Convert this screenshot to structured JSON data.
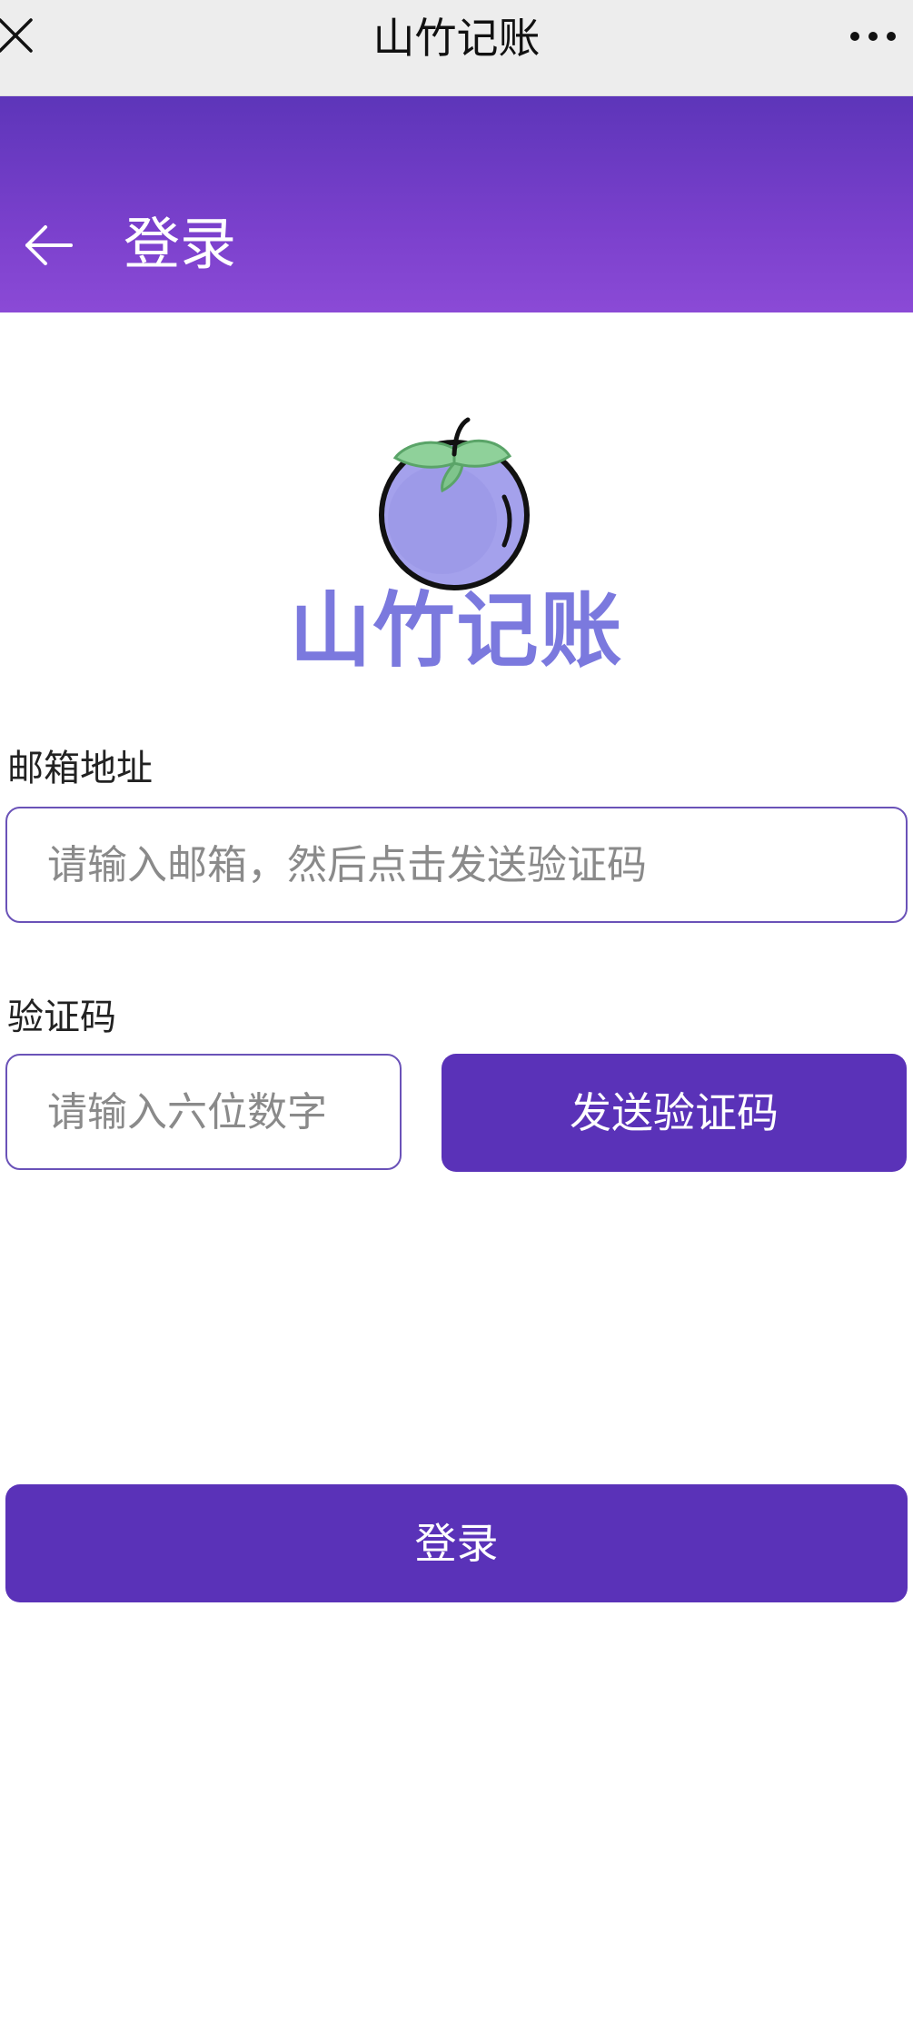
{
  "topbar": {
    "title": "山竹记账",
    "close_icon": "close-icon",
    "more_icon": "more-dots-icon"
  },
  "header": {
    "back_icon": "arrow-left-icon",
    "title": "登录",
    "gradient_colors": [
      "#5d35b9",
      "#8b4ad6"
    ]
  },
  "logo": {
    "icon": "mangosteen-icon",
    "brand_text": "山竹记账",
    "brand_color": "#7b79de"
  },
  "form": {
    "email_label": "邮箱地址",
    "email_placeholder": "请输入邮箱，然后点击发送验证码",
    "code_label": "验证码",
    "code_placeholder": "请输入六位数字",
    "send_button_label": "发送验证码",
    "login_button_label": "登录",
    "accent_color": "#5a32b8"
  }
}
